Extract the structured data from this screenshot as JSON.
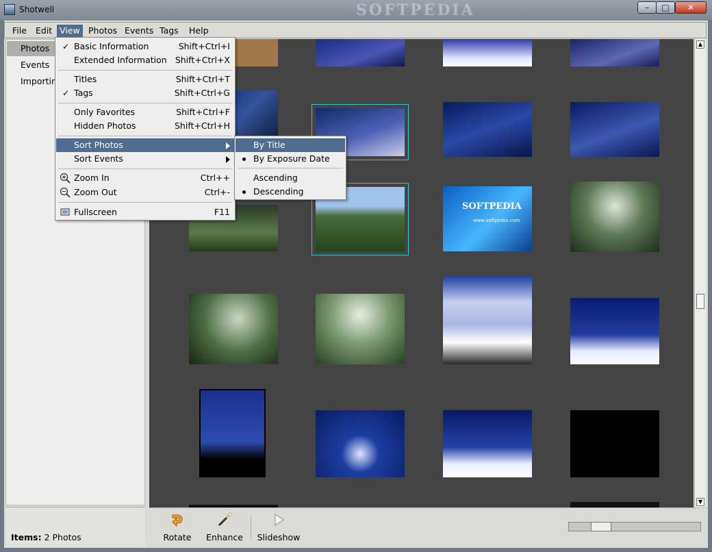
{
  "window": {
    "title": "Shotwell",
    "watermark": "SOFTPEDIA"
  },
  "menubar": {
    "items": [
      "File",
      "Edit",
      "View",
      "Photos",
      "Events",
      "Tags",
      "Help"
    ]
  },
  "sidebar": {
    "items": [
      "Photos",
      "Events",
      "Importing"
    ],
    "selected": "Photos"
  },
  "status": {
    "label": "Items:",
    "value": "2 Photos"
  },
  "view_menu": {
    "basic_info": {
      "label": "Basic Information",
      "accel": "Shift+Ctrl+I"
    },
    "extended_info": {
      "label": "Extended Information",
      "accel": "Shift+Ctrl+X"
    },
    "titles": {
      "label": "Titles",
      "accel": "Shift+Ctrl+T"
    },
    "tags": {
      "label": "Tags",
      "accel": "Shift+Ctrl+G"
    },
    "only_favorites": {
      "label": "Only Favorites",
      "accel": "Shift+Ctrl+F"
    },
    "hidden_photos": {
      "label": "Hidden Photos",
      "accel": "Shift+Ctrl+H"
    },
    "sort_photos": {
      "label": "Sort Photos"
    },
    "sort_events": {
      "label": "Sort Events"
    },
    "zoom_in": {
      "label": "Zoom In",
      "accel": "Ctrl++"
    },
    "zoom_out": {
      "label": "Zoom Out",
      "accel": "Ctrl+-"
    },
    "fullscreen": {
      "label": "Fullscreen",
      "accel": "F11"
    }
  },
  "sort_submenu": {
    "by_title": "By Title",
    "by_exposure_date": "By Exposure Date",
    "ascending": "Ascending",
    "descending": "Descending"
  },
  "toolbar": {
    "rotate": "Rotate",
    "enhance": "Enhance",
    "slideshow": "Slideshow"
  },
  "icons": [
    "check-icon",
    "bullet-icon",
    "zoom-in-icon",
    "zoom-out-icon",
    "fullscreen-icon",
    "rotate-icon",
    "enhance-icon",
    "slideshow-icon",
    "minimize-icon",
    "maximize-icon",
    "close-icon"
  ],
  "photo_watermark_text": "SOFTPEDIA",
  "photo_url_text": "www.softpedia.com"
}
